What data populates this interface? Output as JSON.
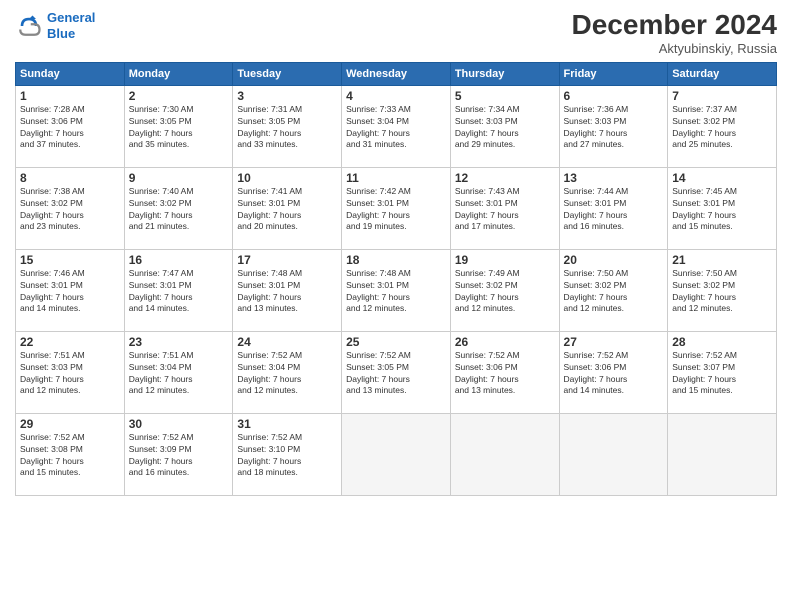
{
  "header": {
    "logo_line1": "General",
    "logo_line2": "Blue",
    "month_title": "December 2024",
    "subtitle": "Aktyubinskiy, Russia"
  },
  "calendar": {
    "days_of_week": [
      "Sunday",
      "Monday",
      "Tuesday",
      "Wednesday",
      "Thursday",
      "Friday",
      "Saturday"
    ],
    "weeks": [
      [
        null,
        null,
        null,
        null,
        {
          "day": "5",
          "sunrise": "Sunrise: 7:34 AM",
          "sunset": "Sunset: 3:03 PM",
          "daylight": "Daylight: 7 hours and 29 minutes."
        },
        {
          "day": "6",
          "sunrise": "Sunrise: 7:36 AM",
          "sunset": "Sunset: 3:03 PM",
          "daylight": "Daylight: 7 hours and 27 minutes."
        },
        {
          "day": "7",
          "sunrise": "Sunrise: 7:37 AM",
          "sunset": "Sunset: 3:02 PM",
          "daylight": "Daylight: 7 hours and 25 minutes."
        }
      ],
      [
        {
          "day": "1",
          "sunrise": "Sunrise: 7:28 AM",
          "sunset": "Sunset: 3:06 PM",
          "daylight": "Daylight: 7 hours and 37 minutes."
        },
        {
          "day": "2",
          "sunrise": "Sunrise: 7:30 AM",
          "sunset": "Sunset: 3:05 PM",
          "daylight": "Daylight: 7 hours and 35 minutes."
        },
        {
          "day": "3",
          "sunrise": "Sunrise: 7:31 AM",
          "sunset": "Sunset: 3:05 PM",
          "daylight": "Daylight: 7 hours and 33 minutes."
        },
        {
          "day": "4",
          "sunrise": "Sunrise: 7:33 AM",
          "sunset": "Sunset: 3:04 PM",
          "daylight": "Daylight: 7 hours and 31 minutes."
        },
        {
          "day": "5",
          "sunrise": "Sunrise: 7:34 AM",
          "sunset": "Sunset: 3:03 PM",
          "daylight": "Daylight: 7 hours and 29 minutes."
        },
        {
          "day": "6",
          "sunrise": "Sunrise: 7:36 AM",
          "sunset": "Sunset: 3:03 PM",
          "daylight": "Daylight: 7 hours and 27 minutes."
        },
        {
          "day": "7",
          "sunrise": "Sunrise: 7:37 AM",
          "sunset": "Sunset: 3:02 PM",
          "daylight": "Daylight: 7 hours and 25 minutes."
        }
      ],
      [
        {
          "day": "8",
          "sunrise": "Sunrise: 7:38 AM",
          "sunset": "Sunset: 3:02 PM",
          "daylight": "Daylight: 7 hours and 23 minutes."
        },
        {
          "day": "9",
          "sunrise": "Sunrise: 7:40 AM",
          "sunset": "Sunset: 3:02 PM",
          "daylight": "Daylight: 7 hours and 21 minutes."
        },
        {
          "day": "10",
          "sunrise": "Sunrise: 7:41 AM",
          "sunset": "Sunset: 3:01 PM",
          "daylight": "Daylight: 7 hours and 20 minutes."
        },
        {
          "day": "11",
          "sunrise": "Sunrise: 7:42 AM",
          "sunset": "Sunset: 3:01 PM",
          "daylight": "Daylight: 7 hours and 19 minutes."
        },
        {
          "day": "12",
          "sunrise": "Sunrise: 7:43 AM",
          "sunset": "Sunset: 3:01 PM",
          "daylight": "Daylight: 7 hours and 17 minutes."
        },
        {
          "day": "13",
          "sunrise": "Sunrise: 7:44 AM",
          "sunset": "Sunset: 3:01 PM",
          "daylight": "Daylight: 7 hours and 16 minutes."
        },
        {
          "day": "14",
          "sunrise": "Sunrise: 7:45 AM",
          "sunset": "Sunset: 3:01 PM",
          "daylight": "Daylight: 7 hours and 15 minutes."
        }
      ],
      [
        {
          "day": "15",
          "sunrise": "Sunrise: 7:46 AM",
          "sunset": "Sunset: 3:01 PM",
          "daylight": "Daylight: 7 hours and 14 minutes."
        },
        {
          "day": "16",
          "sunrise": "Sunrise: 7:47 AM",
          "sunset": "Sunset: 3:01 PM",
          "daylight": "Daylight: 7 hours and 14 minutes."
        },
        {
          "day": "17",
          "sunrise": "Sunrise: 7:48 AM",
          "sunset": "Sunset: 3:01 PM",
          "daylight": "Daylight: 7 hours and 13 minutes."
        },
        {
          "day": "18",
          "sunrise": "Sunrise: 7:48 AM",
          "sunset": "Sunset: 3:01 PM",
          "daylight": "Daylight: 7 hours and 12 minutes."
        },
        {
          "day": "19",
          "sunrise": "Sunrise: 7:49 AM",
          "sunset": "Sunset: 3:02 PM",
          "daylight": "Daylight: 7 hours and 12 minutes."
        },
        {
          "day": "20",
          "sunrise": "Sunrise: 7:50 AM",
          "sunset": "Sunset: 3:02 PM",
          "daylight": "Daylight: 7 hours and 12 minutes."
        },
        {
          "day": "21",
          "sunrise": "Sunrise: 7:50 AM",
          "sunset": "Sunset: 3:02 PM",
          "daylight": "Daylight: 7 hours and 12 minutes."
        }
      ],
      [
        {
          "day": "22",
          "sunrise": "Sunrise: 7:51 AM",
          "sunset": "Sunset: 3:03 PM",
          "daylight": "Daylight: 7 hours and 12 minutes."
        },
        {
          "day": "23",
          "sunrise": "Sunrise: 7:51 AM",
          "sunset": "Sunset: 3:04 PM",
          "daylight": "Daylight: 7 hours and 12 minutes."
        },
        {
          "day": "24",
          "sunrise": "Sunrise: 7:52 AM",
          "sunset": "Sunset: 3:04 PM",
          "daylight": "Daylight: 7 hours and 12 minutes."
        },
        {
          "day": "25",
          "sunrise": "Sunrise: 7:52 AM",
          "sunset": "Sunset: 3:05 PM",
          "daylight": "Daylight: 7 hours and 13 minutes."
        },
        {
          "day": "26",
          "sunrise": "Sunrise: 7:52 AM",
          "sunset": "Sunset: 3:06 PM",
          "daylight": "Daylight: 7 hours and 13 minutes."
        },
        {
          "day": "27",
          "sunrise": "Sunrise: 7:52 AM",
          "sunset": "Sunset: 3:06 PM",
          "daylight": "Daylight: 7 hours and 14 minutes."
        },
        {
          "day": "28",
          "sunrise": "Sunrise: 7:52 AM",
          "sunset": "Sunset: 3:07 PM",
          "daylight": "Daylight: 7 hours and 15 minutes."
        }
      ],
      [
        {
          "day": "29",
          "sunrise": "Sunrise: 7:52 AM",
          "sunset": "Sunset: 3:08 PM",
          "daylight": "Daylight: 7 hours and 15 minutes."
        },
        {
          "day": "30",
          "sunrise": "Sunrise: 7:52 AM",
          "sunset": "Sunset: 3:09 PM",
          "daylight": "Daylight: 7 hours and 16 minutes."
        },
        {
          "day": "31",
          "sunrise": "Sunrise: 7:52 AM",
          "sunset": "Sunset: 3:10 PM",
          "daylight": "Daylight: 7 hours and 18 minutes."
        },
        null,
        null,
        null,
        null
      ]
    ]
  }
}
